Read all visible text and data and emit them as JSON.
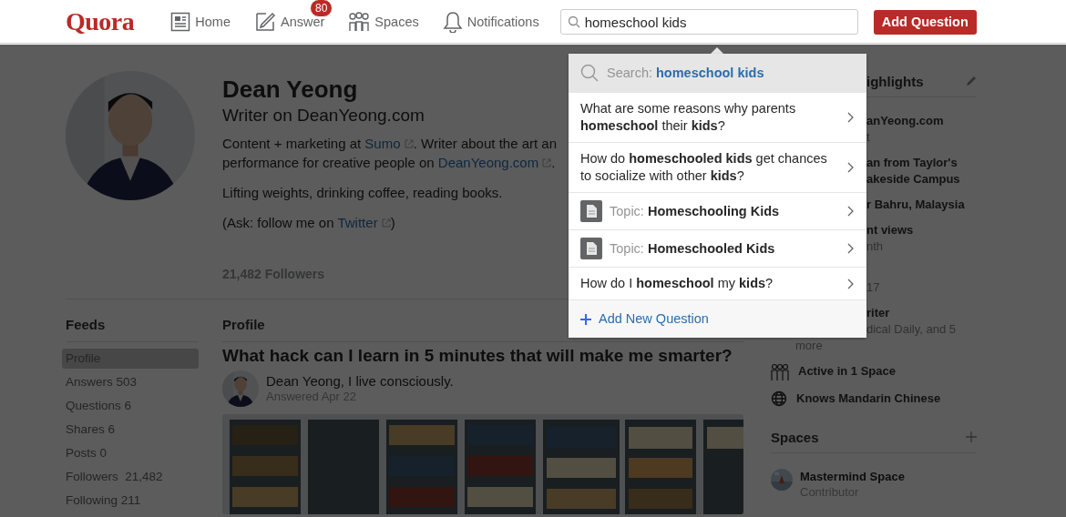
{
  "header": {
    "logo": "Quora",
    "nav": [
      {
        "kind": "home",
        "label": "Home"
      },
      {
        "kind": "answer",
        "label": "Answer",
        "badge": "80"
      },
      {
        "kind": "spaces",
        "label": "Spaces"
      },
      {
        "kind": "notifications",
        "label": "Notifications"
      }
    ],
    "search": {
      "value": "homeschool kids"
    },
    "add_button": "Add Question"
  },
  "profile": {
    "name": "Dean Yeong",
    "tagline": "Writer on DeanYeong.com",
    "bio": [
      [
        {
          "kind": "text",
          "text": "Content + marketing at "
        },
        {
          "kind": "link",
          "text": "Sumo"
        },
        {
          "kind": "text",
          "text": ". Writer about the art an"
        }
      ],
      [
        {
          "kind": "text",
          "text": "performance for creative people on "
        },
        {
          "kind": "link",
          "text": "DeanYeong.com"
        },
        {
          "kind": "text",
          "text": "."
        }
      ]
    ],
    "paragraphs": [
      [
        {
          "kind": "text",
          "text": "Lifting weights, drinking coffee, reading books."
        }
      ],
      [
        {
          "kind": "text",
          "text": "(Ask: follow me on "
        },
        {
          "kind": "link",
          "text": "Twitter"
        },
        {
          "kind": "text",
          "text": ")"
        }
      ]
    ],
    "followers": "21,482 Followers"
  },
  "feeds": {
    "title": "Feeds",
    "items": [
      {
        "label": "Profile",
        "selected": true
      },
      {
        "label": "Answers",
        "count": "503",
        "selected": false
      },
      {
        "label": "Questions",
        "count": "6",
        "selected": false
      },
      {
        "label": "Shares",
        "count": "6",
        "selected": false
      },
      {
        "label": "Posts",
        "count": "0",
        "selected": false
      },
      {
        "label": "Followers",
        "count": "21,482",
        "selected": false
      },
      {
        "label": "Following",
        "count": "211",
        "selected": false
      }
    ]
  },
  "main": {
    "title": "Profile",
    "question": "What hack can I learn in 5 minutes that will make me smarter?",
    "author": "Dean Yeong, I live consciously.",
    "answered": "Answered Apr 22"
  },
  "highlights": {
    "title": "ighlights",
    "entries": [
      {
        "lines": [
          {
            "text": "anYeong.com",
            "muted": false,
            "covered": true
          },
          {
            "text": "t",
            "muted": true,
            "covered": true
          }
        ]
      },
      {
        "lines": [
          {
            "text": "an from Taylor's",
            "muted": false,
            "covered": true
          },
          {
            "text": "akeside Campus",
            "muted": false,
            "covered": true
          }
        ]
      },
      {
        "lines": [
          {
            "text": "r Bahru, Malaysia",
            "muted": false,
            "covered": true
          }
        ]
      },
      {
        "lines": [
          {
            "text": "nt views",
            "muted": false,
            "covered": true
          },
          {
            "text": "nth",
            "muted": true,
            "covered": true
          }
        ]
      },
      {
        "lines": [
          {
            "text": "17",
            "muted": true,
            "covered": true
          }
        ]
      },
      {
        "lines": [
          {
            "text": "riter",
            "muted": false,
            "covered": true
          },
          {
            "text": "dical Daily, and 5",
            "muted": true,
            "covered": true
          },
          {
            "text": "more",
            "muted": true,
            "covered": false
          }
        ]
      },
      {
        "kind": "spaces",
        "lines": [
          {
            "text": "Active in 1 Space",
            "muted": false
          }
        ]
      },
      {
        "kind": "language",
        "lines": [
          {
            "text": "Knows Mandarin Chinese",
            "muted": false
          }
        ]
      }
    ]
  },
  "spaces": {
    "title": "Spaces",
    "items": [
      {
        "name": "Mastermind Space",
        "role": "Contributor"
      }
    ]
  },
  "dropdown": {
    "items": [
      {
        "kind": "search",
        "prefix": "Search:",
        "text": "**homeschool kids**"
      },
      {
        "kind": "question",
        "text": "What are some reasons why parents **homeschool** their **kids**?"
      },
      {
        "kind": "question",
        "text": "How do **homeschooled kids** get chances to socialize with other **kids**?"
      },
      {
        "kind": "topic",
        "prefix": "Topic:",
        "text": "**Homeschooling Kids**"
      },
      {
        "kind": "topic",
        "prefix": "Topic:",
        "text": "**Homeschooled Kids**"
      },
      {
        "kind": "question",
        "text": "How do I **homeschool** my **kids**?"
      },
      {
        "kind": "add",
        "text": "Add New Question"
      }
    ]
  }
}
